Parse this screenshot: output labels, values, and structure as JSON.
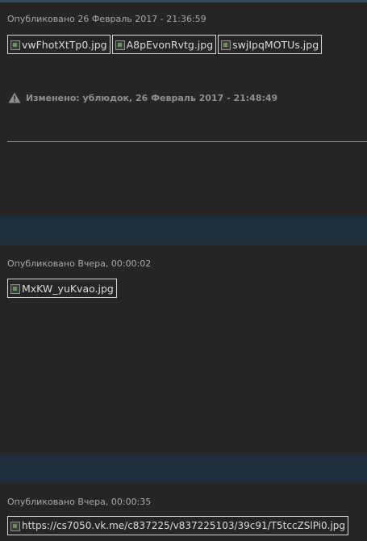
{
  "posts": [
    {
      "published": "Опубликовано 26 Февраль 2017 - 21:36:59",
      "images": [
        "vwFhotXtTp0.jpg",
        "A8pEvonRvtg.jpg",
        "swjIpqMOTUs.jpg"
      ],
      "edited": "Изменено: ублюдок, 26 Февраль 2017 - 21:48:49"
    },
    {
      "published": "Опубликовано Вчера, 00:00:02",
      "images": [
        "MxKW_yuKvao.jpg"
      ]
    },
    {
      "published": "Опубликовано Вчера, 00:00:35",
      "images": [
        "https://cs7050.vk.me/c837225/v837225103/39c91/T5tccZSlPi0.jpg"
      ]
    }
  ],
  "icons": {
    "warning": "warning-triangle-icon",
    "broken_image": "broken-image-icon"
  },
  "colors": {
    "background": "#252525",
    "band": "#1f2d3b",
    "meta_text": "#a9a9a9",
    "edited_text": "#8f8f8f"
  }
}
